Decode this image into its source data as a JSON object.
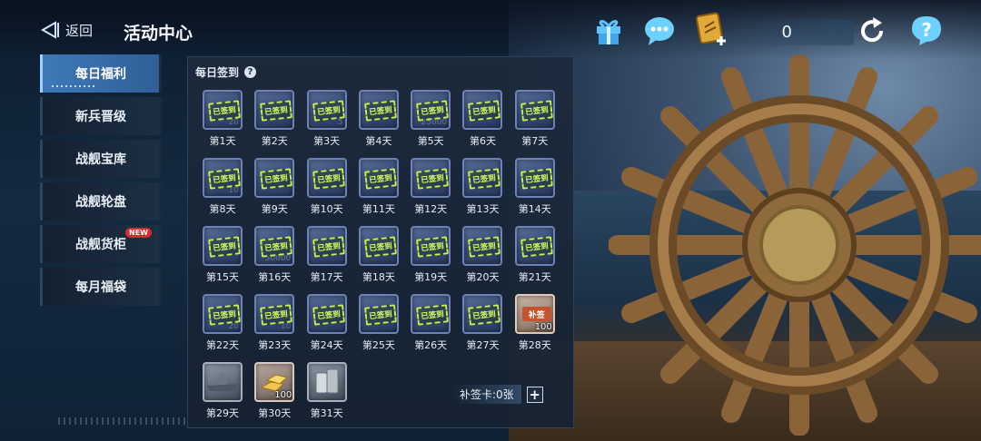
{
  "header": {
    "back_label": "返回",
    "title": "活动中心",
    "currency_count": "0"
  },
  "sidebar": {
    "items": [
      {
        "label": "每日福利",
        "active": true
      },
      {
        "label": "新兵晋级"
      },
      {
        "label": "战舰宝库"
      },
      {
        "label": "战舰轮盘"
      },
      {
        "label": "战舰货柜",
        "badge": "NEW"
      },
      {
        "label": "每月福袋"
      }
    ]
  },
  "checkin": {
    "heading": "每日签到",
    "help": "?",
    "stamp_text": "已签到",
    "makeup_tag": "补签",
    "card_label": "补签卡:0张",
    "card_add": "+",
    "days": [
      {
        "label": "第1天",
        "state": "signed",
        "ghost": "20"
      },
      {
        "label": "第2天",
        "state": "signed",
        "ghost": ""
      },
      {
        "label": "第3天",
        "state": "signed",
        "ghost": "5"
      },
      {
        "label": "第4天",
        "state": "signed",
        "ghost": ""
      },
      {
        "label": "第5天",
        "state": "signed",
        "ghost": "25000"
      },
      {
        "label": "第6天",
        "state": "signed",
        "ghost": ""
      },
      {
        "label": "第7天",
        "state": "signed",
        "ghost": ""
      },
      {
        "label": "第8天",
        "state": "signed",
        "ghost": "10"
      },
      {
        "label": "第9天",
        "state": "signed",
        "ghost": ""
      },
      {
        "label": "第10天",
        "state": "signed",
        "ghost": ""
      },
      {
        "label": "第11天",
        "state": "signed",
        "ghost": ""
      },
      {
        "label": "第12天",
        "state": "signed",
        "ghost": ""
      },
      {
        "label": "第13天",
        "state": "signed",
        "ghost": ""
      },
      {
        "label": "第14天",
        "state": "signed",
        "ghost": ""
      },
      {
        "label": "第15天",
        "state": "signed",
        "ghost": ""
      },
      {
        "label": "第16天",
        "state": "signed",
        "ghost": "50000"
      },
      {
        "label": "第17天",
        "state": "signed",
        "ghost": ""
      },
      {
        "label": "第18天",
        "state": "signed",
        "ghost": ""
      },
      {
        "label": "第19天",
        "state": "signed",
        "ghost": ""
      },
      {
        "label": "第20天",
        "state": "signed",
        "ghost": ""
      },
      {
        "label": "第21天",
        "state": "signed",
        "ghost": ""
      },
      {
        "label": "第22天",
        "state": "signed",
        "ghost": "20"
      },
      {
        "label": "第23天",
        "state": "signed",
        "ghost": "10"
      },
      {
        "label": "第24天",
        "state": "signed",
        "ghost": ""
      },
      {
        "label": "第25天",
        "state": "signed",
        "ghost": ""
      },
      {
        "label": "第26天",
        "state": "signed",
        "ghost": ""
      },
      {
        "label": "第27天",
        "state": "signed",
        "ghost": ""
      },
      {
        "label": "第28天",
        "state": "makeup",
        "qty": "100"
      },
      {
        "label": "第29天",
        "state": "reward",
        "kind": "ship"
      },
      {
        "label": "第30天",
        "state": "reward",
        "kind": "gold",
        "qty": "100"
      },
      {
        "label": "第31天",
        "state": "reward",
        "kind": "parts"
      }
    ]
  },
  "colors": {
    "accent": "#3f79b8",
    "stamp": "#c9f44a",
    "badge": "#d42b2b"
  }
}
